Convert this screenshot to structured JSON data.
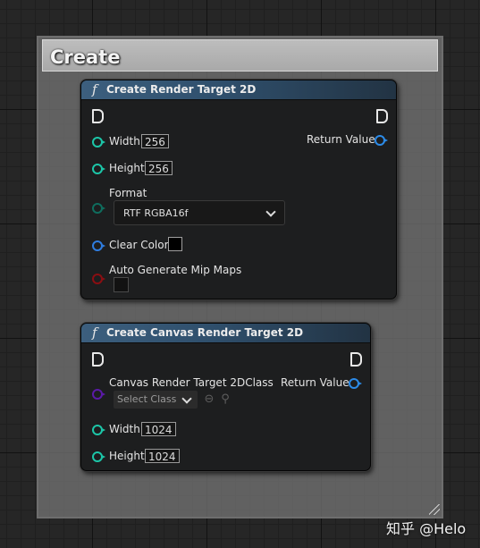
{
  "comment": {
    "title": "Create"
  },
  "node1": {
    "title": "Create Render Target 2D",
    "width_label": "Width",
    "width_value": "256",
    "height_label": "Height",
    "height_value": "256",
    "format_label": "Format",
    "format_value": "RTF RGBA16f",
    "clear_color_label": "Clear Color",
    "auto_mip_label": "Auto Generate Mip Maps",
    "return_label": "Return Value"
  },
  "node2": {
    "title": "Create Canvas Render Target 2D",
    "class_label": "Canvas Render Target 2DClass",
    "select_class_value": "Select Class",
    "width_label": "Width",
    "width_value": "1024",
    "height_label": "Height",
    "height_value": "1024",
    "return_label": "Return Value"
  },
  "icons": {
    "function": "function-icon",
    "exec": "exec-pin-icon",
    "browse": "arrow-left-circle-icon",
    "search": "search-icon",
    "dropdown": "chevron-down-icon"
  },
  "colors": {
    "node_header": "#3c5f7e",
    "pin_integer": "#1cc6a8",
    "pin_color": "#2f7de0",
    "pin_bool": "#8a0e12",
    "pin_class": "#5b1aa8",
    "pin_object": "#2c8be8"
  },
  "watermark": "知乎 @Helo"
}
